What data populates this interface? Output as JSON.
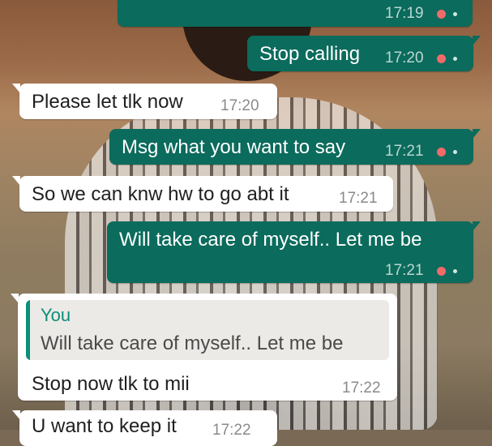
{
  "chat": {
    "messages": [
      {
        "direction": "outgoing",
        "text": "",
        "time": "17:19"
      },
      {
        "direction": "outgoing",
        "text": "Stop calling",
        "time": "17:20"
      },
      {
        "direction": "incoming",
        "text": "Please let tlk now",
        "time": "17:20"
      },
      {
        "direction": "outgoing",
        "text": "Msg what you want to say",
        "time": "17:21"
      },
      {
        "direction": "incoming",
        "text": "So we can knw hw to go abt it",
        "time": "17:21"
      },
      {
        "direction": "outgoing",
        "text": "Will take care of myself.. Let me be",
        "time": "17:21"
      },
      {
        "direction": "incoming",
        "quote": {
          "author": "You",
          "text": "Will take care of myself.. Let me be"
        },
        "text": "Stop now tlk to mii",
        "time": "17:22"
      },
      {
        "direction": "incoming",
        "text": "U want to keep it",
        "time": "17:22"
      }
    ]
  },
  "icons": {
    "status": "double-check-icon",
    "status_color": "#ef6b6b"
  },
  "colors": {
    "outgoing_bubble": "#0b6b5c",
    "incoming_bubble": "#ffffff",
    "quote_accent": "#0b8e7a"
  }
}
